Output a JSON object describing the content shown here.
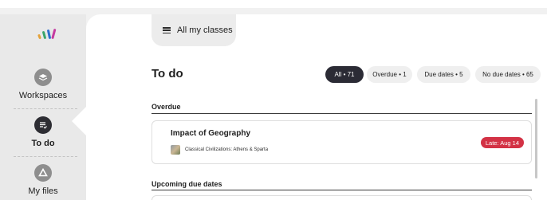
{
  "sidebar": {
    "items": [
      {
        "label": "Workspaces",
        "icon": "layers-icon"
      },
      {
        "label": "To do",
        "icon": "todo-icon"
      },
      {
        "label": "My files",
        "icon": "drive-icon"
      }
    ]
  },
  "header": {
    "class_selector": "All my classes"
  },
  "page": {
    "title": "To do",
    "filters": [
      {
        "label": "All • 71",
        "active": true
      },
      {
        "label": "Overdue • 1",
        "active": false
      },
      {
        "label": "Due dates • 5",
        "active": false
      },
      {
        "label": "No due dates • 65",
        "active": false
      }
    ]
  },
  "sections": {
    "overdue": {
      "title": "Overdue",
      "card": {
        "title": "Impact of Geography",
        "class_name": "Classical Civilizations: Athens & Sparta",
        "status": "Late: Aug 14"
      }
    },
    "upcoming": {
      "title": "Upcoming due dates"
    }
  },
  "colors": {
    "active_filter": "#2b2b35",
    "late_badge": "#d33245"
  }
}
